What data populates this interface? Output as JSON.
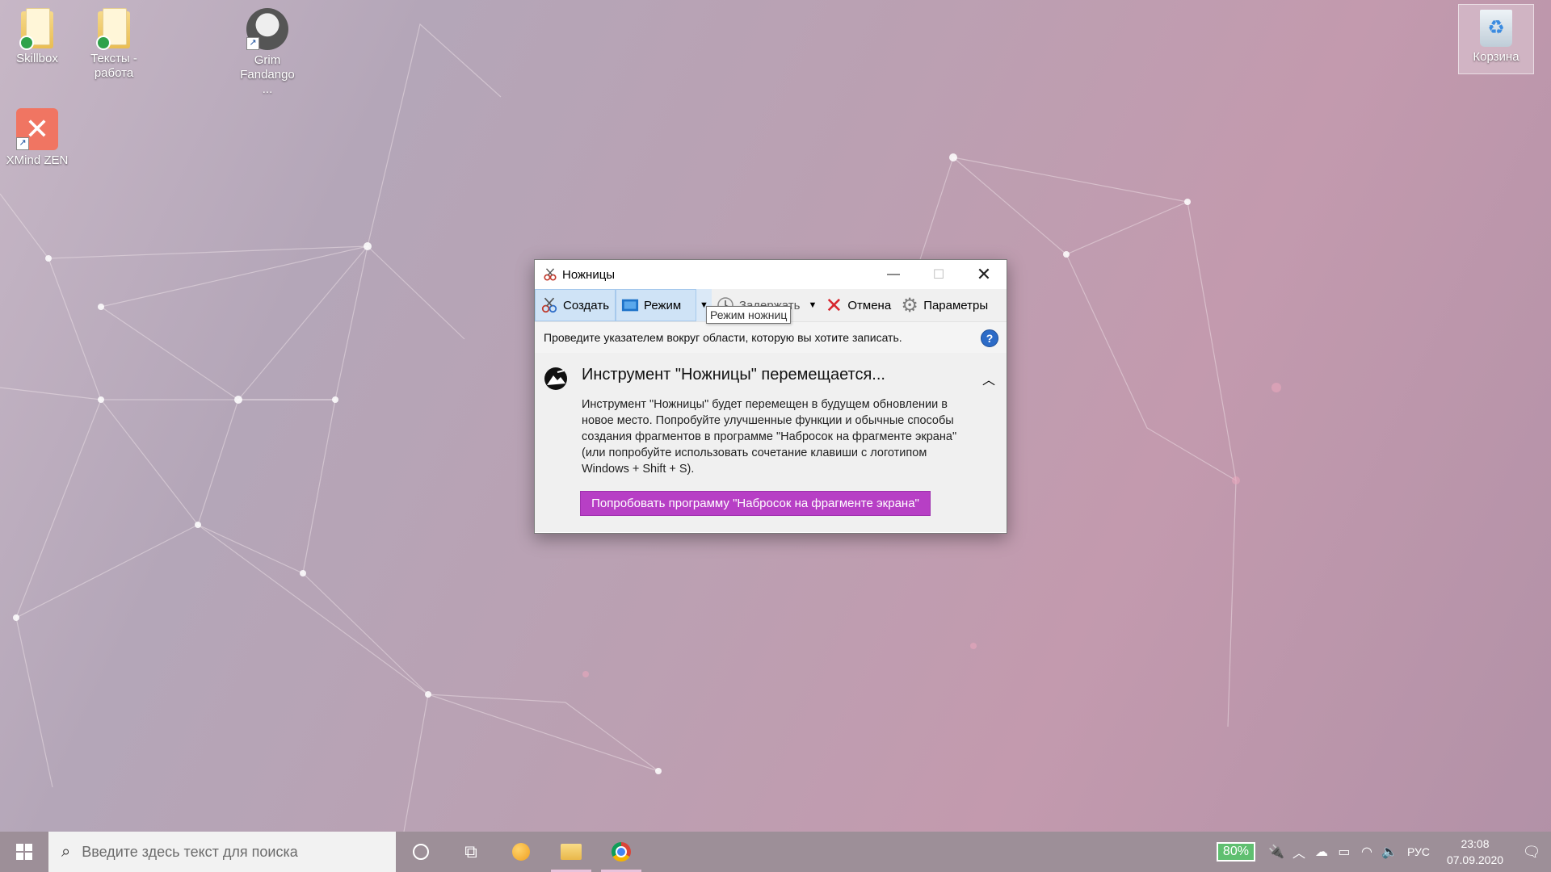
{
  "desktop": {
    "icons": [
      {
        "label": "Skillbox"
      },
      {
        "label": "Тексты - работа"
      },
      {
        "label": "Grim Fandango ..."
      },
      {
        "label": "XMind ZEN"
      },
      {
        "label": "Корзина"
      }
    ]
  },
  "window": {
    "title": "Ножницы",
    "toolbar": {
      "create": "Создать",
      "mode": "Режим",
      "delay": "Задержать",
      "cancel": "Отмена",
      "options": "Параметры"
    },
    "tooltip": "Режим ножниц",
    "hint": "Проведите указателем вокруг области, которую вы хотите записать.",
    "help": "?",
    "notice": {
      "title": "Инструмент \"Ножницы\" перемещается...",
      "body": "Инструмент \"Ножницы\" будет перемещен в будущем обновлении в новое место. Попробуйте улучшенные функции и обычные способы создания фрагментов в программе \"Набросок на фрагменте экрана\" (или попробуйте использовать сочетание клавиши с логотипом Windows + Shift + S).",
      "button": "Попробовать программу \"Набросок на фрагменте экрана\""
    }
  },
  "taskbar": {
    "search_placeholder": "Введите здесь текст для поиска",
    "battery": "80%",
    "language": "РУС",
    "time": "23:08",
    "date": "07.09.2020"
  },
  "colors": {
    "accent_button": "#b73fc5",
    "taskbar": "#9d8f98",
    "battery": "#5fbf70"
  }
}
